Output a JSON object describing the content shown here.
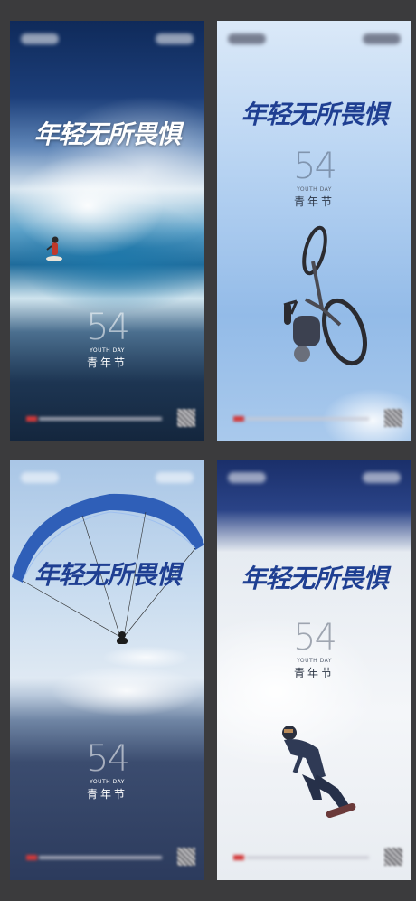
{
  "posters": [
    {
      "title": "年轻无所畏惧",
      "number": "54",
      "subtitle": "YOUTH DAY",
      "festival": "青年节",
      "theme": "surf",
      "title_color": "#ffffff"
    },
    {
      "title": "年轻无所畏惧",
      "number": "54",
      "subtitle": "YOUTH DAY",
      "festival": "青年节",
      "theme": "bike",
      "title_color": "#1f3f92"
    },
    {
      "title": "年轻无所畏惧",
      "number": "54",
      "subtitle": "YOUTH DAY",
      "festival": "青年节",
      "theme": "paraglide",
      "title_color": "#1f3f92"
    },
    {
      "title": "年轻无所畏惧",
      "number": "54",
      "subtitle": "YOUTH DAY",
      "festival": "青年节",
      "theme": "snowboard",
      "title_color": "#1f3f92"
    }
  ]
}
